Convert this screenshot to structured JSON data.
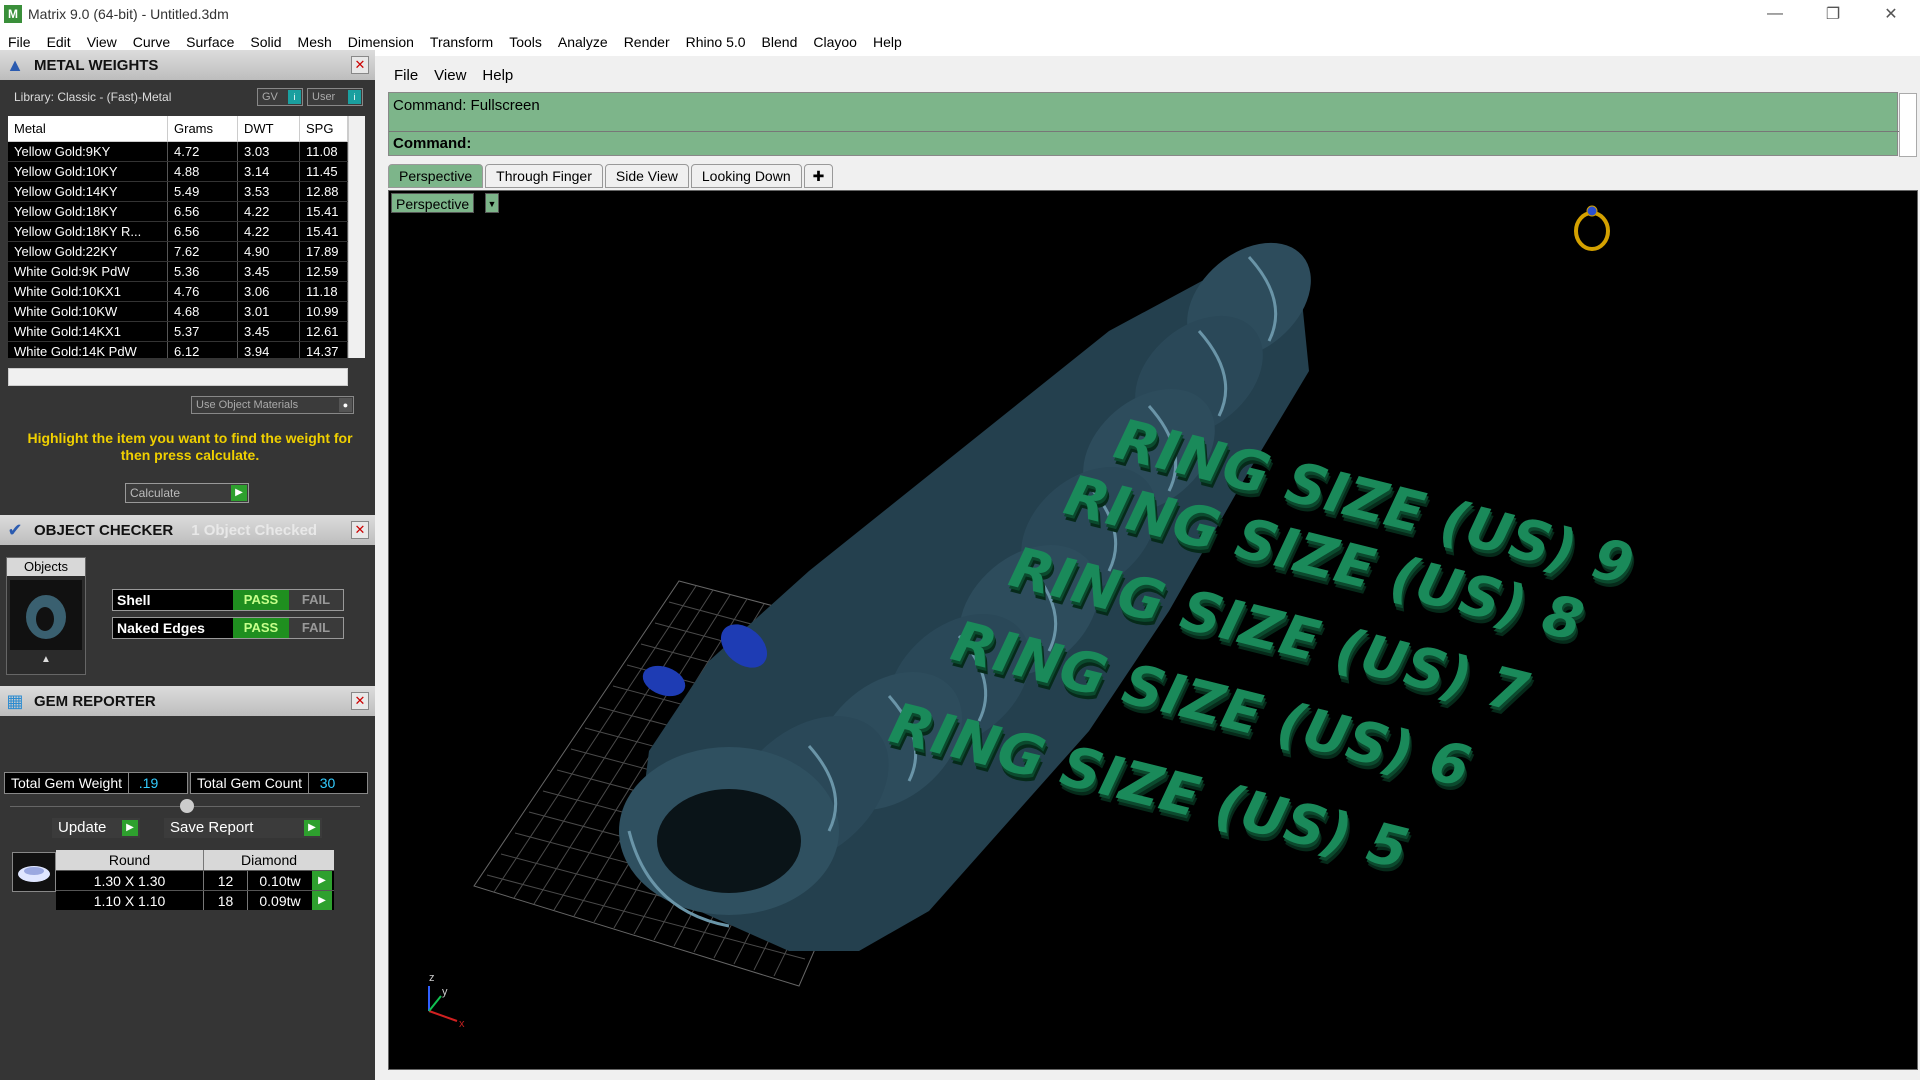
{
  "window": {
    "title": "Matrix 9.0 (64-bit) - Untitled.3dm"
  },
  "menubar": [
    "File",
    "Edit",
    "View",
    "Curve",
    "Surface",
    "Solid",
    "Mesh",
    "Dimension",
    "Transform",
    "Tools",
    "Analyze",
    "Render",
    "Rhino 5.0",
    "Blend",
    "Clayoo",
    "Help"
  ],
  "metal_weights": {
    "title": "METAL WEIGHTS",
    "library": "Library: Classic - (Fast)-Metal",
    "btn_gv": "GV",
    "btn_user": "User",
    "columns": [
      "Metal",
      "Grams",
      "DWT",
      "SPG"
    ],
    "rows": [
      [
        "Yellow Gold:9KY",
        "4.72",
        "3.03",
        "11.08"
      ],
      [
        "Yellow Gold:10KY",
        "4.88",
        "3.14",
        "11.45"
      ],
      [
        "Yellow Gold:14KY",
        "5.49",
        "3.53",
        "12.88"
      ],
      [
        "Yellow Gold:18KY",
        "6.56",
        "4.22",
        "15.41"
      ],
      [
        "Yellow Gold:18KY R...",
        "6.56",
        "4.22",
        "15.41"
      ],
      [
        "Yellow Gold:22KY",
        "7.62",
        "4.90",
        "17.89"
      ],
      [
        "White Gold:9K PdW",
        "5.36",
        "3.45",
        "12.59"
      ],
      [
        "White Gold:10KX1",
        "4.76",
        "3.06",
        "11.18"
      ],
      [
        "White Gold:10KW",
        "4.68",
        "3.01",
        "10.99"
      ],
      [
        "White Gold:14KX1",
        "5.37",
        "3.45",
        "12.61"
      ],
      [
        "White Gold:14K PdW",
        "6.12",
        "3.94",
        "14.37"
      ]
    ],
    "use_object_materials": "Use Object Materials",
    "hint": "Highlight the item you want to find the weight for then press calculate.",
    "calculate": "Calculate"
  },
  "object_checker": {
    "title": "OBJECT CHECKER",
    "status": "1 Object Checked",
    "objects_label": "Objects",
    "checks": [
      {
        "name": "Shell",
        "pass": "PASS",
        "fail": "FAIL"
      },
      {
        "name": "Naked Edges",
        "pass": "PASS",
        "fail": "FAIL"
      }
    ]
  },
  "gem_reporter": {
    "title": "GEM REPORTER",
    "total_weight_label": "Total Gem Weight",
    "total_weight": ".19",
    "total_count_label": "Total Gem Count",
    "total_count": "30",
    "update": "Update",
    "save_report": "Save Report",
    "head": [
      "Round",
      "Diamond"
    ],
    "rows": [
      [
        "1.30 X 1.30",
        "12",
        "0.10tw"
      ],
      [
        "1.10 X 1.10",
        "18",
        "0.09tw"
      ]
    ]
  },
  "right_menu": [
    "File",
    "View",
    "Help"
  ],
  "command": {
    "history": "Command: Fullscreen",
    "prompt": "Command:"
  },
  "tabs": [
    "Perspective",
    "Through Finger",
    "Side View",
    "Looking Down"
  ],
  "viewport": {
    "label": "Perspective",
    "ring_labels": [
      "RING SIZE (US)   9",
      "RING SIZE (US)   8",
      "RING SIZE (US)   7",
      "RING SIZE (US)   6",
      "RING SIZE (US)   5"
    ],
    "axis_x": "x",
    "axis_y": "y",
    "axis_z": "z"
  },
  "colors": {
    "accent_green": "#7db58a",
    "ring_text": "#1a8a5a",
    "ring_metal": "#2d4c5c",
    "gem_blue": "#1e3cb4"
  }
}
